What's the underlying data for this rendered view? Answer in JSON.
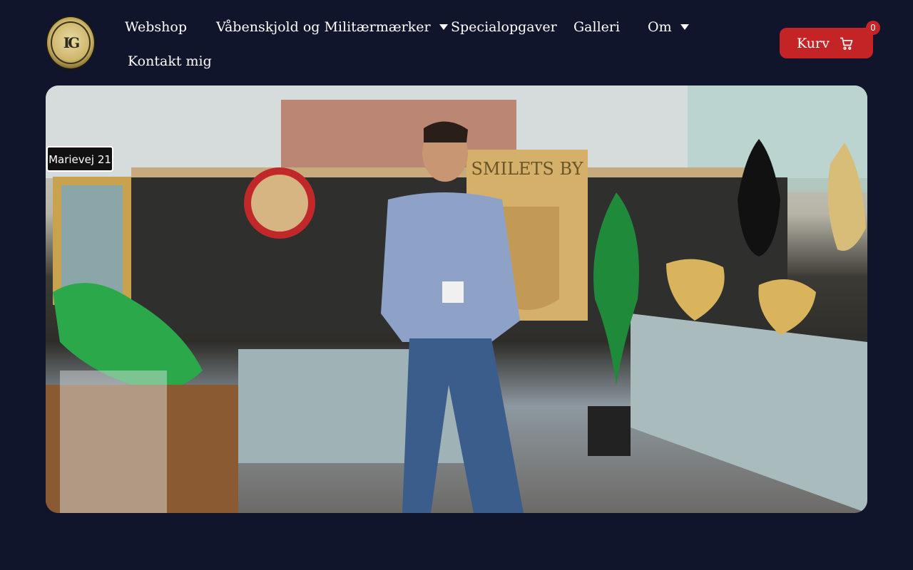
{
  "brand": {
    "logo_alt": "Ingemanns Gravering logo",
    "logo_text": "IG"
  },
  "nav": {
    "items": [
      {
        "label": "Webshop",
        "has_dropdown": false
      },
      {
        "label": "Våbenskjold og Militærmærker",
        "has_dropdown": true
      },
      {
        "label": "Specialopgaver",
        "has_dropdown": false
      },
      {
        "label": "Galleri",
        "has_dropdown": false
      },
      {
        "label": "Om",
        "has_dropdown": true
      },
      {
        "label": "Kontakt mig",
        "has_dropdown": false
      }
    ]
  },
  "cart": {
    "label": "Kurv",
    "count": "0",
    "icon": "cart-icon"
  },
  "hero": {
    "image_alt": "Man standing in front of carved wooden coats of arms at an exhibition",
    "sign_text": "Marievej 21",
    "panel_text": "SMILETS BY"
  },
  "colors": {
    "background": "#11152b",
    "accent": "#c42426",
    "text": "#ffffff"
  }
}
